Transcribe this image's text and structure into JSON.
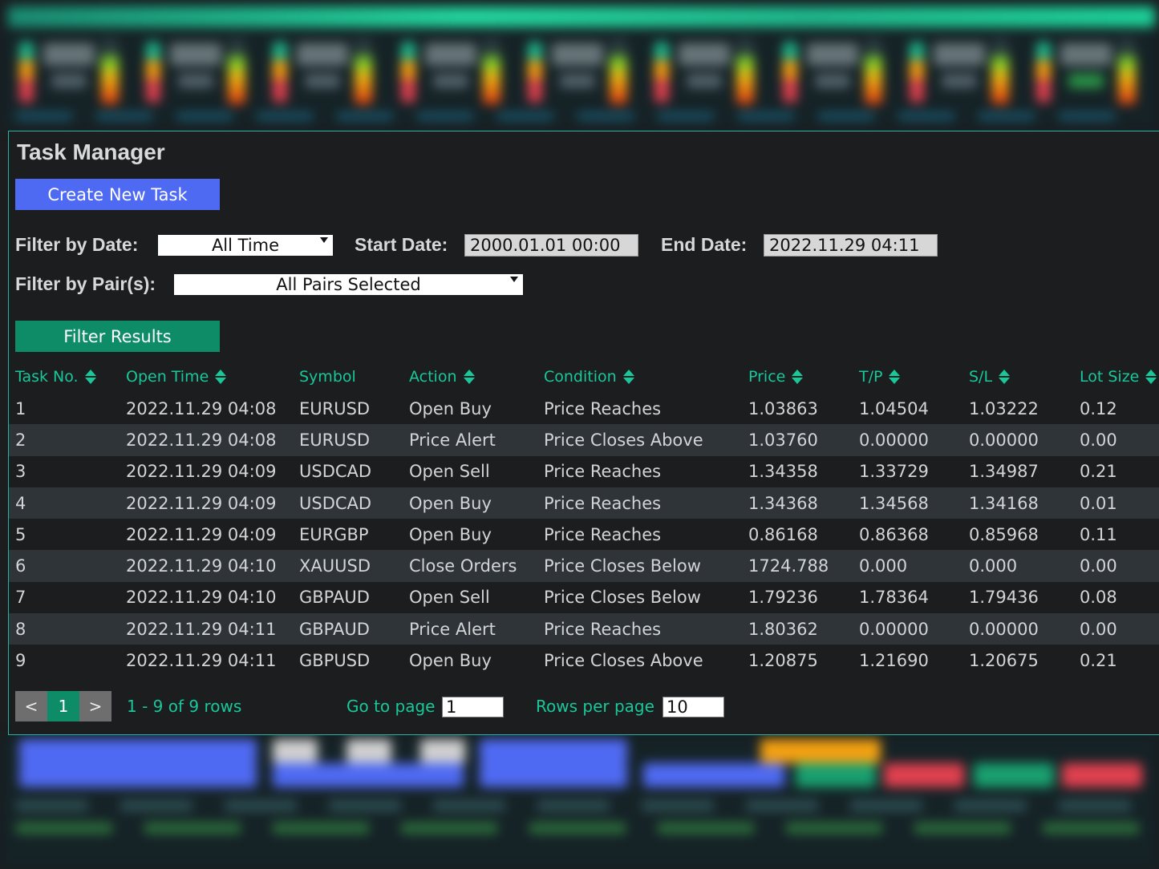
{
  "panel": {
    "title": "Task Manager",
    "create_button": "Create New Task",
    "filters": {
      "date_label": "Filter by Date:",
      "date_value": "All Time",
      "start_label": "Start Date:",
      "start_value": "2000.01.01 00:00",
      "end_label": "End Date:",
      "end_value": "2022.11.29 04:11",
      "pairs_label": "Filter by Pair(s):",
      "pairs_value": "All Pairs Selected",
      "filter_button": "Filter Results"
    },
    "columns": [
      "Task No.",
      "Open Time",
      "Symbol",
      "Action",
      "Condition",
      "Price",
      "T/P",
      "S/L",
      "Lot Size"
    ],
    "rows": [
      [
        "1",
        "2022.11.29 04:08",
        "EURUSD",
        "Open Buy",
        "Price Reaches",
        "1.03863",
        "1.04504",
        "1.03222",
        "0.12"
      ],
      [
        "2",
        "2022.11.29 04:08",
        "EURUSD",
        "Price Alert",
        "Price Closes Above",
        "1.03760",
        "0.00000",
        "0.00000",
        "0.00"
      ],
      [
        "3",
        "2022.11.29 04:09",
        "USDCAD",
        "Open Sell",
        "Price Reaches",
        "1.34358",
        "1.33729",
        "1.34987",
        "0.21"
      ],
      [
        "4",
        "2022.11.29 04:09",
        "USDCAD",
        "Open Buy",
        "Price Reaches",
        "1.34368",
        "1.34568",
        "1.34168",
        "0.01"
      ],
      [
        "5",
        "2022.11.29 04:09",
        "EURGBP",
        "Open Buy",
        "Price Reaches",
        "0.86168",
        "0.86368",
        "0.85968",
        "0.11"
      ],
      [
        "6",
        "2022.11.29 04:10",
        "XAUUSD",
        "Close Orders",
        "Price Closes Below",
        "1724.788",
        "0.000",
        "0.000",
        "0.00"
      ],
      [
        "7",
        "2022.11.29 04:10",
        "GBPAUD",
        "Open Sell",
        "Price Closes Below",
        "1.79236",
        "1.78364",
        "1.79436",
        "0.08"
      ],
      [
        "8",
        "2022.11.29 04:11",
        "GBPAUD",
        "Price Alert",
        "Price Reaches",
        "1.80362",
        "0.00000",
        "0.00000",
        "0.00"
      ],
      [
        "9",
        "2022.11.29 04:11",
        "GBPUSD",
        "Open Buy",
        "Price Closes Above",
        "1.20875",
        "1.21690",
        "1.20675",
        "0.21"
      ]
    ],
    "pagination": {
      "prev": "<",
      "current": "1",
      "next": ">",
      "summary": "1 - 9 of 9 rows",
      "goto_label": "Go to page",
      "goto_value": "1",
      "rows_label": "Rows per page",
      "rows_value": "10"
    }
  },
  "colors": {
    "accent": "#19c79a",
    "create_button": "#4f6af2",
    "filter_button": "#0e8c68",
    "panel_border": "#1fb6a5",
    "row_alt": "#2e3438"
  },
  "icons": {
    "sort": "sort-arrows-icon",
    "dropdown": "caret-down-icon"
  }
}
